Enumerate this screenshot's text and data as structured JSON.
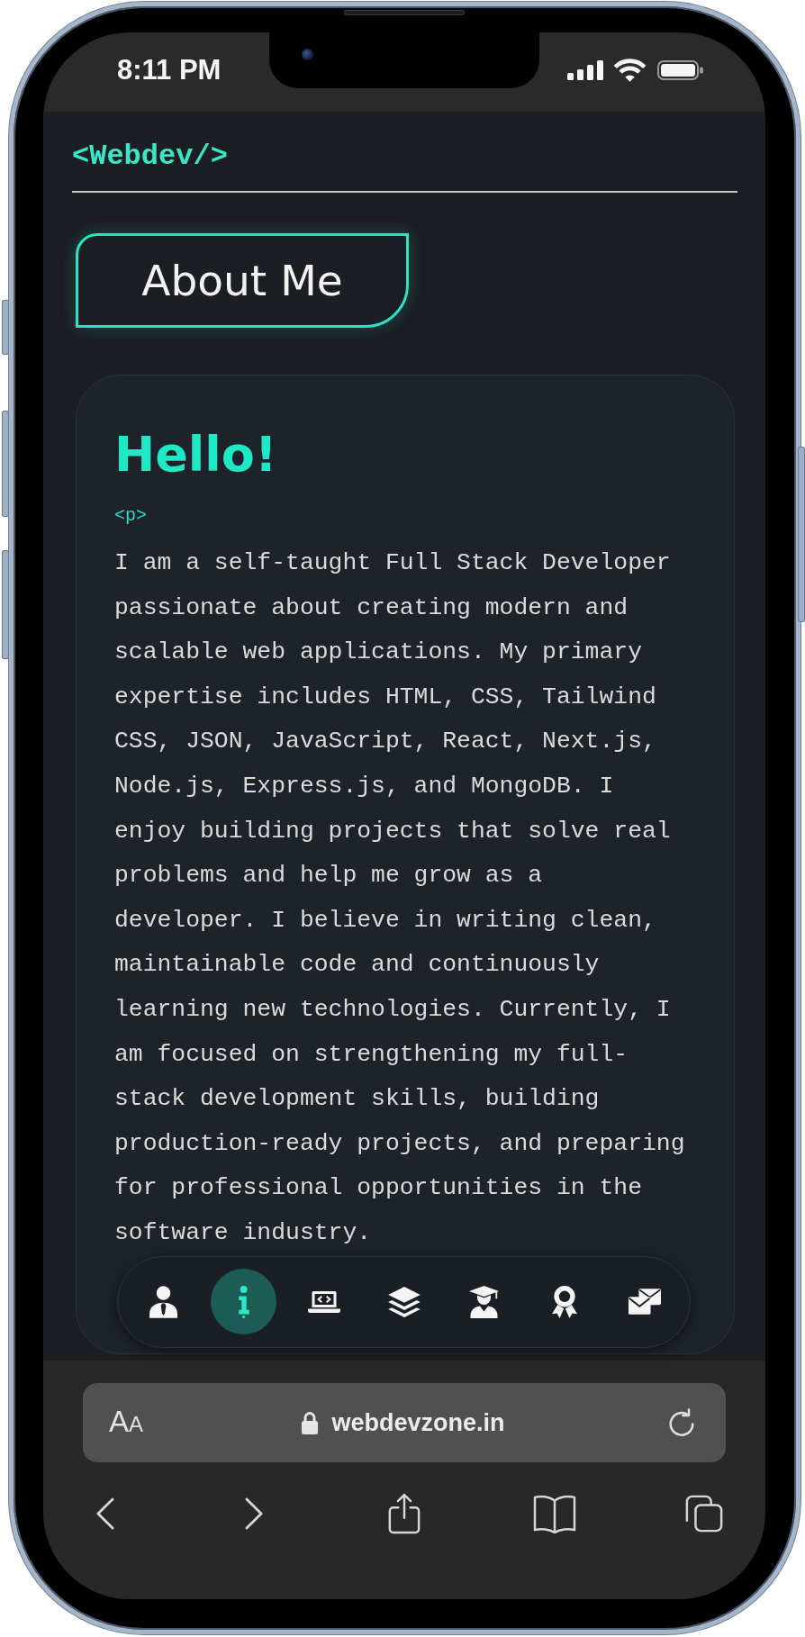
{
  "status_bar": {
    "time": "8:11 PM"
  },
  "header": {
    "logo": "<Webdev/>"
  },
  "section": {
    "title": "About Me"
  },
  "about_card": {
    "heading": "Hello!",
    "tag": "<p>",
    "text": "I am a self-taught Full Stack Developer passionate about creating modern and scalable web applications. My primary expertise includes HTML, CSS, Tailwind CSS, JSON, JavaScript, React, Next.js, Node.js, Express.js, and MongoDB. I enjoy building projects that solve real problems and help me grow as a developer. I believe in writing clean, maintainable code and continuously learning new technologies. Currently, I am focused on strengthening my full-stack development skills, building production-ready projects, and preparing for professional opportunities in the software industry."
  },
  "bottom_nav": [
    {
      "kind": "person",
      "selected": false
    },
    {
      "kind": "info",
      "selected": true
    },
    {
      "kind": "laptop",
      "selected": false
    },
    {
      "kind": "layers",
      "selected": false
    },
    {
      "kind": "graduate",
      "selected": false
    },
    {
      "kind": "award",
      "selected": false
    },
    {
      "kind": "mail",
      "selected": false
    }
  ],
  "browser": {
    "text_size": "AA",
    "secure": true,
    "url": "webdevzone.in"
  }
}
